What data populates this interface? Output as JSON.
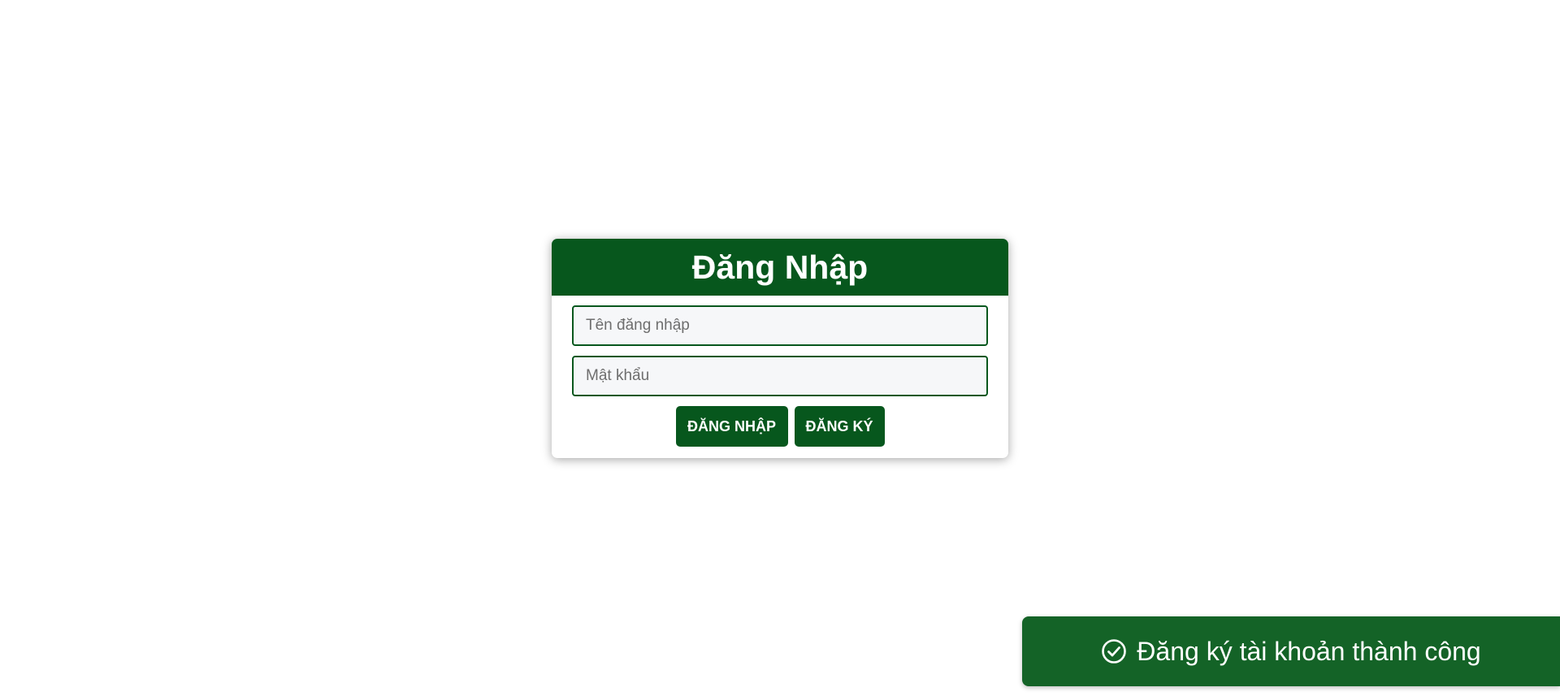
{
  "login": {
    "title": "Đăng Nhập",
    "username_placeholder": "Tên đăng nhập",
    "password_placeholder": "Mật khẩu",
    "login_button": "ĐĂNG NHẬP",
    "register_button": "ĐĂNG KÝ"
  },
  "toast": {
    "icon": "check-circle-icon",
    "message": "Đăng ký tài khoản thành công"
  },
  "colors": {
    "primary_green": "#07571d",
    "toast_green": "#146327",
    "input_bg": "#f6f7f9"
  }
}
